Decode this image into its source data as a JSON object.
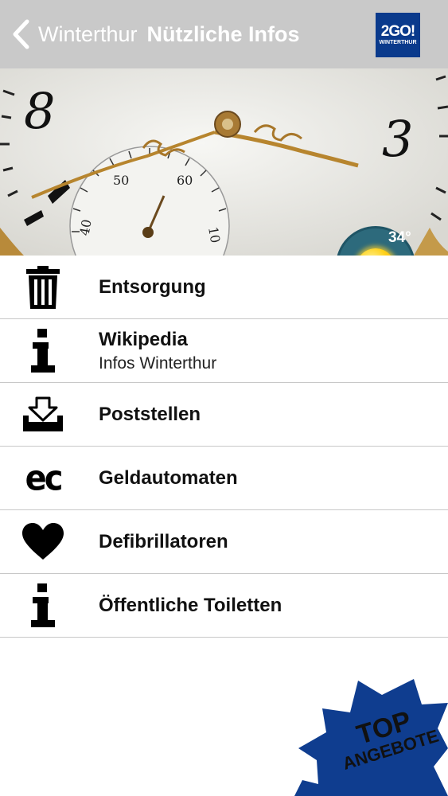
{
  "header": {
    "back_label": "Winterthur",
    "title": "Nützliche Infos",
    "logo_main": "2GO!",
    "logo_sub": "WINTERTHUR",
    "bg_color": "#c9c9c9"
  },
  "hero": {
    "weather_temp": "34°",
    "weather_icon": "sun-icon"
  },
  "list": {
    "items": [
      {
        "icon": "trash-icon",
        "label": "Entsorgung"
      },
      {
        "icon": "info-icon",
        "label": "Wikipedia",
        "sublabel": "Infos Winterthur"
      },
      {
        "icon": "inbox-download-icon",
        "label": "Poststellen"
      },
      {
        "icon": "ec-icon",
        "label": "Geldautomaten",
        "glyph": "ec"
      },
      {
        "icon": "heart-icon",
        "label": "Defibrillatoren"
      },
      {
        "icon": "info-icon",
        "label": "Öffentliche Toiletten"
      }
    ]
  },
  "badge": {
    "line1": "TOP",
    "line2": "ANGEBOTE",
    "color": "#0f3d8f"
  }
}
